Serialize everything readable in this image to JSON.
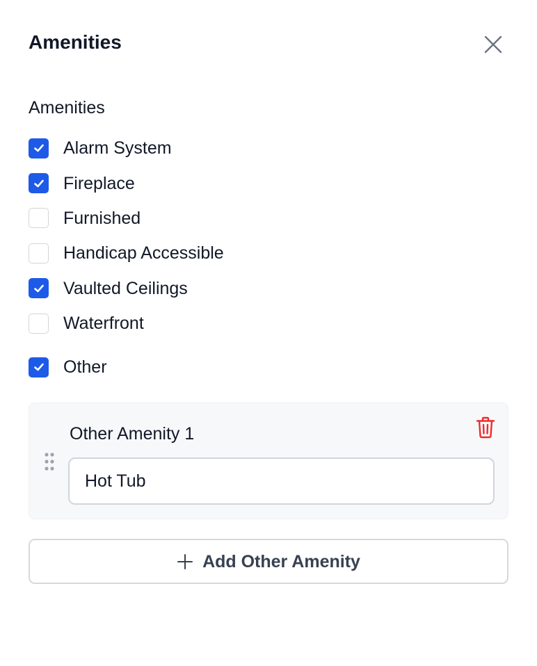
{
  "dialog": {
    "title": "Amenities",
    "close_icon": "close-icon"
  },
  "amenities": {
    "section_label": "Amenities",
    "items": [
      {
        "label": "Alarm System",
        "checked": true
      },
      {
        "label": "Fireplace",
        "checked": true
      },
      {
        "label": "Furnished",
        "checked": false
      },
      {
        "label": "Handicap Accessible",
        "checked": false
      },
      {
        "label": "Vaulted Ceilings",
        "checked": true
      },
      {
        "label": "Waterfront",
        "checked": false
      }
    ],
    "other": {
      "label": "Other",
      "checked": true
    }
  },
  "other_amenities": [
    {
      "label": "Other Amenity 1",
      "value": "Hot Tub"
    }
  ],
  "add_button": {
    "label": "Add Other Amenity",
    "icon": "plus-icon"
  },
  "colors": {
    "accent": "#1d5ae8",
    "danger": "#ef2b2b",
    "text": "#111827",
    "muted": "#6b7280",
    "card_bg": "#f7f8fa",
    "border": "#d1d5db"
  }
}
